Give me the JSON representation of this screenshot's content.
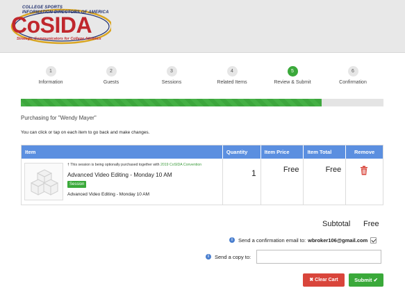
{
  "header": {
    "logo_top_line1": "COLLEGE SPORTS",
    "logo_top_line2": "INFORMATION DIRECTORS OF AMERICA",
    "logo_name": "CoSIDA",
    "logo_tagline": "Strategic Communicators for College Athletics"
  },
  "steps": [
    {
      "num": "1",
      "label": "Information"
    },
    {
      "num": "2",
      "label": "Guests"
    },
    {
      "num": "3",
      "label": "Sessions"
    },
    {
      "num": "4",
      "label": "Related Items"
    },
    {
      "num": "5",
      "label": "Review & Submit"
    },
    {
      "num": "6",
      "label": "Confirmation"
    }
  ],
  "active_step": 5,
  "progress": 0.83,
  "purchasing_for": "Purchasing for \"Wendy Mayer\"",
  "note": "You can click or tap on each item to go back and make changes.",
  "table": {
    "headers": {
      "item": "Item",
      "quantity": "Quantity",
      "price": "Item Price",
      "total": "Item Total",
      "remove": "Remove"
    },
    "rows": [
      {
        "option_note_prefix": "† This session is being optionally purchased together with",
        "option_note_link": "2019 CoSIDA Convention",
        "session_title": "Advanced Video Editing - Monday 10 AM",
        "badge": "Session",
        "session_sub": "Advanced Video Editing - Monday 10 AM",
        "quantity": "1",
        "price": "Free",
        "total": "Free"
      }
    ]
  },
  "subtotal": {
    "label": "Subtotal",
    "value": "Free"
  },
  "confirmation": {
    "label": "Send a confirmation email to:",
    "email": "wbroker106@gmail.com",
    "checked": true
  },
  "copy": {
    "label": "Send a copy to:",
    "value": "",
    "placeholder": ""
  },
  "buttons": {
    "clear": "✖ Clear Cart",
    "submit": "Submit ✔"
  },
  "colors": {
    "accent_green": "#3aa93a",
    "header_blue": "#5b8fe0",
    "danger_red": "#d9453b",
    "brand_red": "#c0272d",
    "brand_navy": "#1f2f6e"
  },
  "icons": [
    "info-icon",
    "trash-icon",
    "checkbox-icon",
    "session-thumbnail-icon"
  ]
}
